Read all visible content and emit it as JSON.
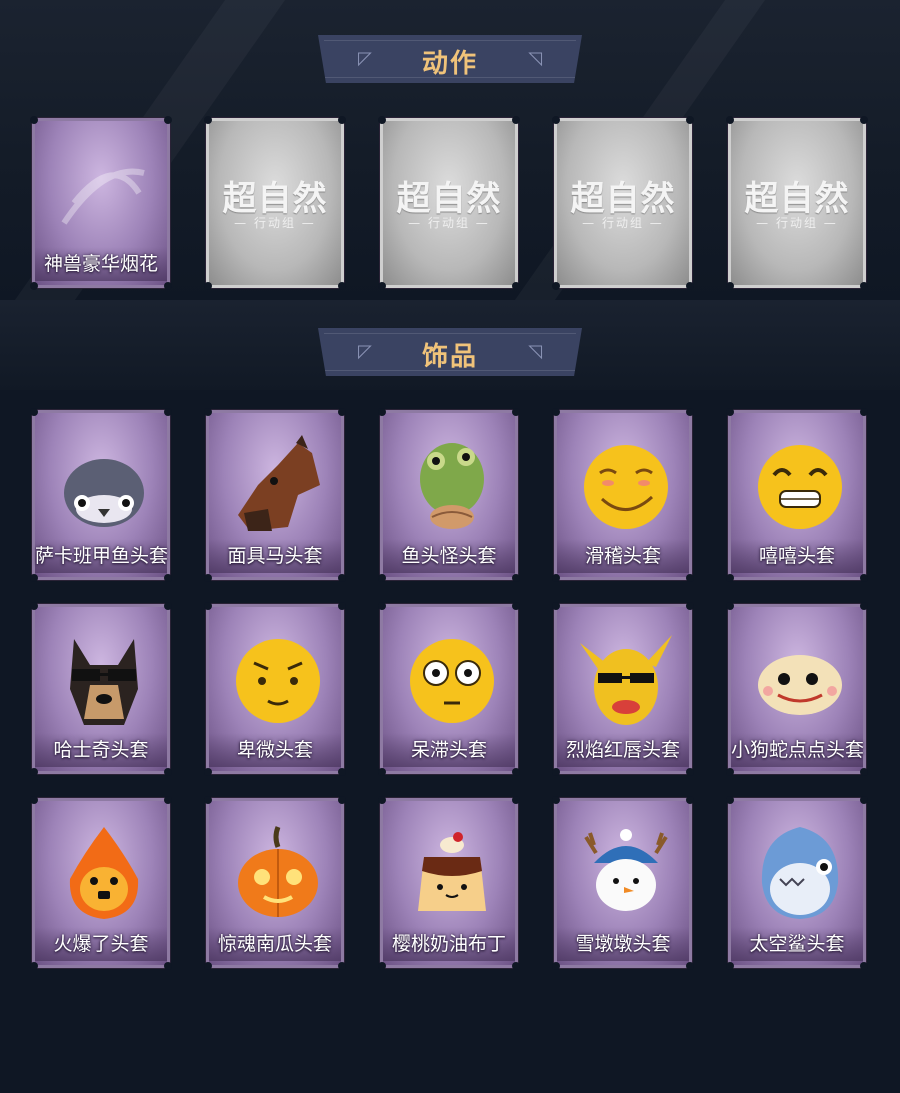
{
  "sections": [
    {
      "title": "动作",
      "items": [
        {
          "label": "神兽豪华烟花",
          "locked": false,
          "art": "firework-card"
        },
        {
          "label": "",
          "locked": true,
          "logo": "超自然",
          "sub": "— 行动组 —"
        },
        {
          "label": "",
          "locked": true,
          "logo": "超自然",
          "sub": "— 行动组 —"
        },
        {
          "label": "",
          "locked": true,
          "logo": "超自然",
          "sub": "— 行动组 —"
        },
        {
          "label": "",
          "locked": true,
          "logo": "超自然",
          "sub": "— 行动组 —"
        }
      ]
    },
    {
      "title": "饰品",
      "items": [
        {
          "label": "萨卡班甲鱼头套",
          "art": "fish-head-icon"
        },
        {
          "label": "面具马头套",
          "art": "horse-head-icon"
        },
        {
          "label": "鱼头怪头套",
          "art": "fish-monster-icon"
        },
        {
          "label": "滑稽头套",
          "art": "smirk-face-icon"
        },
        {
          "label": "嘻嘻头套",
          "art": "grin-face-icon"
        },
        {
          "label": "哈士奇头套",
          "art": "dog-head-icon"
        },
        {
          "label": "卑微头套",
          "art": "shy-face-icon"
        },
        {
          "label": "呆滞头套",
          "art": "stare-face-icon"
        },
        {
          "label": "烈焰红唇头套",
          "art": "pikachu-head-icon"
        },
        {
          "label": "小狗蛇点点头套",
          "art": "snake-head-icon"
        },
        {
          "label": "火爆了头套",
          "art": "fire-spirit-icon"
        },
        {
          "label": "惊魂南瓜头套",
          "art": "pumpkin-head-icon"
        },
        {
          "label": "樱桃奶油布丁",
          "art": "pudding-head-icon"
        },
        {
          "label": "雪墩墩头套",
          "art": "snowman-head-icon"
        },
        {
          "label": "太空鲨头套",
          "art": "shark-head-icon"
        }
      ]
    }
  ],
  "colors": {
    "background": "#0f1724",
    "banner": "#3a4362",
    "title": "#f0c37a",
    "card": "#9d83b8",
    "locked": "#b8b8b8"
  }
}
